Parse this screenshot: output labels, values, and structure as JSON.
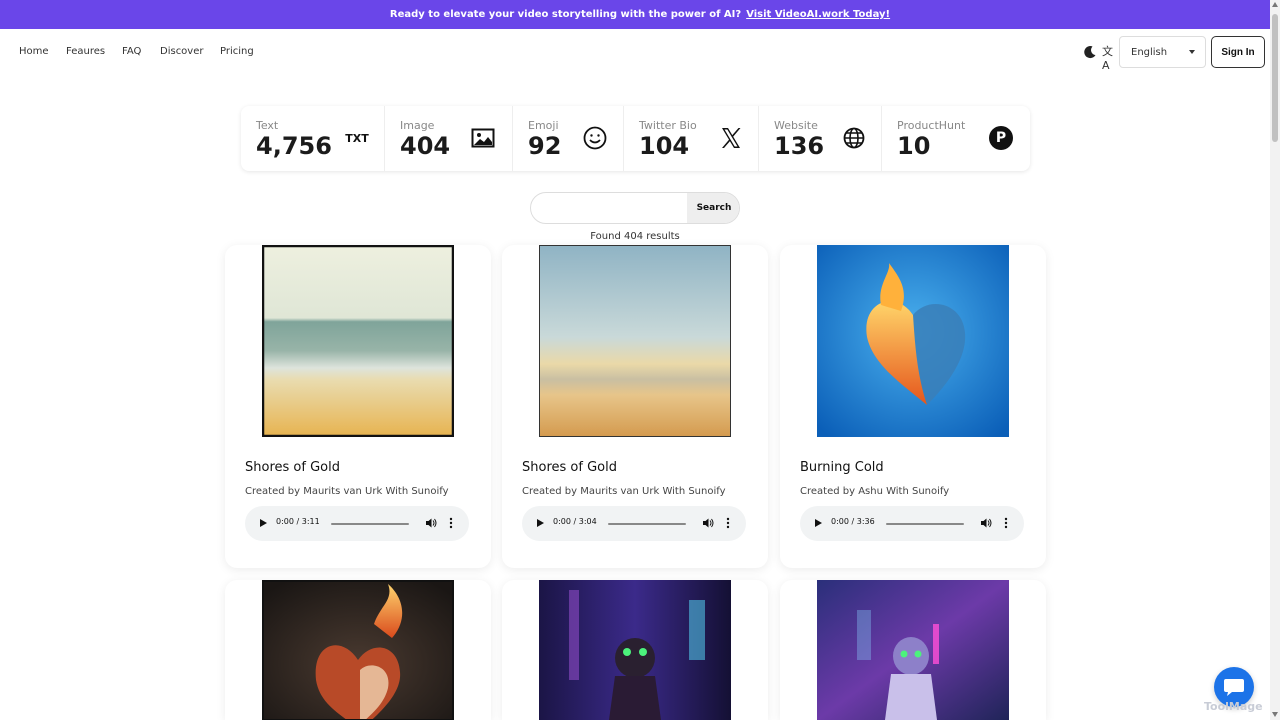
{
  "banner": {
    "text": "Ready to elevate your video storytelling with the power of AI?",
    "link_text": "Visit VideoAI.work Today!"
  },
  "nav": {
    "links": [
      "Home",
      "Feaures",
      "FAQ",
      "Discover",
      "Pricing"
    ],
    "language": "English",
    "sign_in": "Sign In"
  },
  "stats": [
    {
      "label": "Text",
      "value": "4,756",
      "icon": "txt-icon"
    },
    {
      "label": "Image",
      "value": "404",
      "icon": "image-icon"
    },
    {
      "label": "Emoji",
      "value": "92",
      "icon": "smiley-icon"
    },
    {
      "label": "Twitter Bio",
      "value": "104",
      "icon": "x-logo-icon"
    },
    {
      "label": "Website",
      "value": "136",
      "icon": "globe-icon"
    },
    {
      "label": "ProductHunt",
      "value": "10",
      "icon": "producthunt-icon"
    }
  ],
  "stat_icon_text": "TXT",
  "producthunt_letter": "P",
  "search": {
    "placeholder": "",
    "button": "Search"
  },
  "results_text": "Found 404 results",
  "cards": [
    {
      "title": "Shores of Gold",
      "author": "Created by Maurits van Urk With Sunoify",
      "time": "0:00 / 3:11"
    },
    {
      "title": "Shores of Gold",
      "author": "Created by Maurits van Urk With Sunoify",
      "time": "0:00 / 3:04"
    },
    {
      "title": "Burning Cold",
      "author": "Created by Ashu With Sunoify",
      "time": "0:00 / 3:36"
    }
  ],
  "watermark": "ToolMage",
  "colors": {
    "banner": "#6a46e9",
    "chat": "#1c73e8"
  }
}
